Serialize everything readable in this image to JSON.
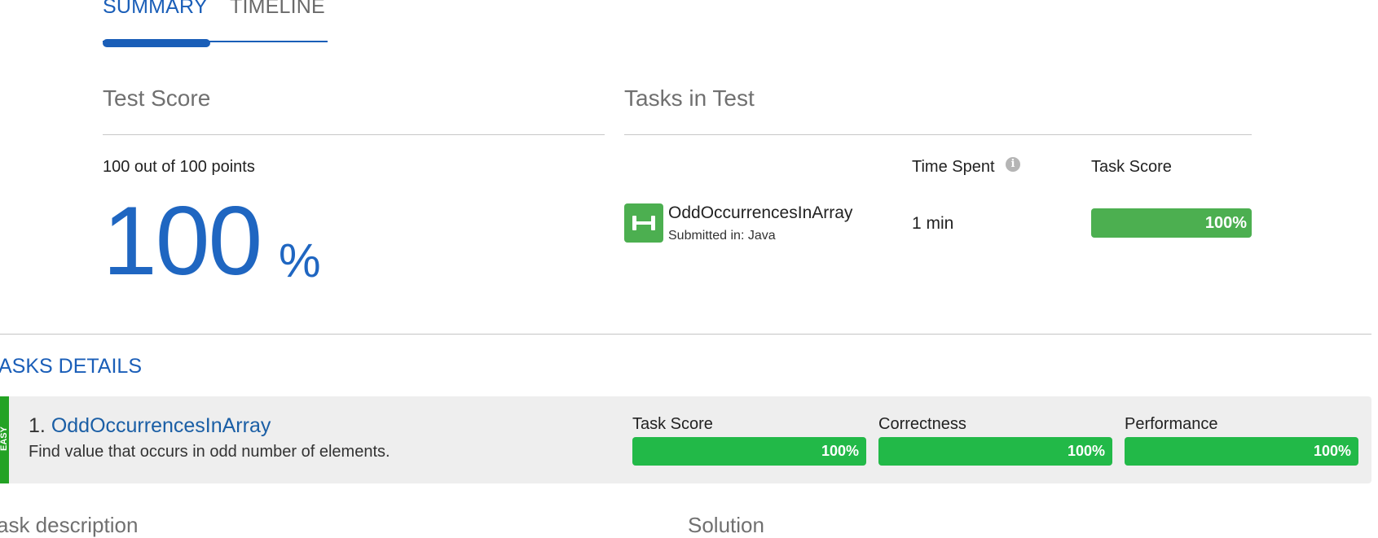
{
  "tabs": [
    {
      "label": "SUMMARY",
      "active": true
    },
    {
      "label": "TIMELINE",
      "active": false
    }
  ],
  "test_score": {
    "title": "Test Score",
    "points_text": "100 out of 100 points",
    "percent_value": "100",
    "percent_sign": "%"
  },
  "tasks_in_test": {
    "title": "Tasks in Test",
    "col_time_spent": "Time Spent",
    "col_task_score": "Task Score",
    "tasks": [
      {
        "icon": "dumbbell-icon",
        "name": "OddOccurrencesInArray",
        "submitted": "Submitted in: Java",
        "time_spent": "1 min",
        "score_label": "100%",
        "score_fraction": 1.0
      }
    ]
  },
  "tasks_details": {
    "title": "ASKS DETAILS",
    "task": {
      "level_label": "EASY",
      "number": "1.",
      "name": "OddOccurrencesInArray",
      "description": "Find value that occurs in odd number of elements.",
      "metrics": [
        {
          "label": "Task Score",
          "value_label": "100%",
          "fraction": 1.0
        },
        {
          "label": "Correctness",
          "value_label": "100%",
          "fraction": 1.0
        },
        {
          "label": "Performance",
          "value_label": "100%",
          "fraction": 1.0
        }
      ]
    }
  },
  "bottom_headings": {
    "task_description": "ask description",
    "solution": "Solution"
  },
  "colors": {
    "accent": "#1a5eb8",
    "score_green": "#4caf50",
    "detail_green": "#22b948",
    "level_green": "#23a224",
    "detail_bg": "#eeeeee"
  }
}
